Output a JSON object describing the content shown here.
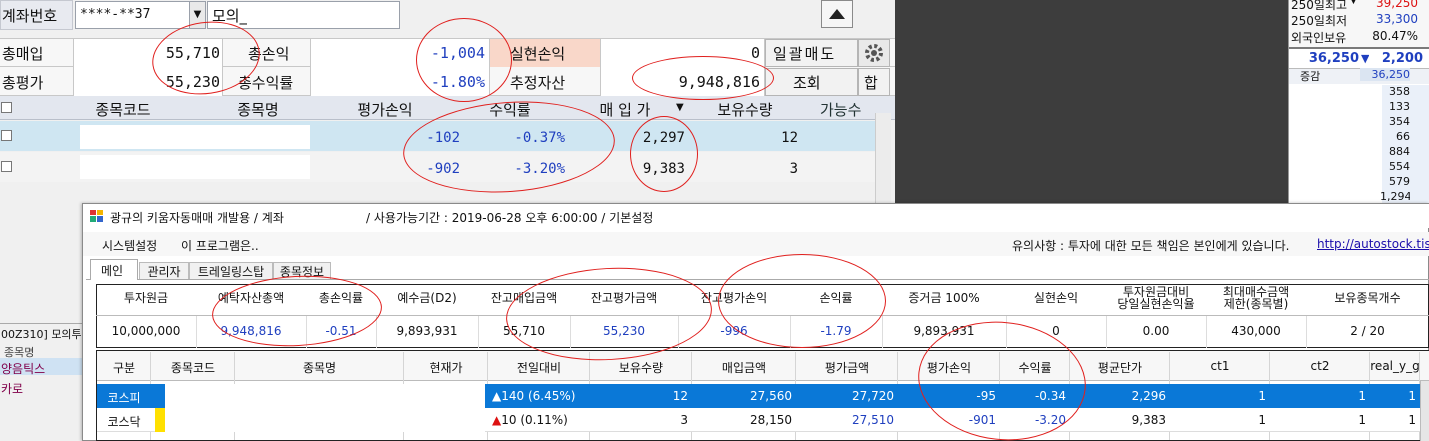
{
  "top": {
    "account_label": "계좌번호",
    "account_value": "****-**37",
    "mode_value": "모의_",
    "row1": {
      "l1": "총매입",
      "v1": "55,710",
      "l2": "총손익",
      "v2": "-1,004",
      "l3": "실현손익",
      "v3": "0",
      "btn": "일괄매도"
    },
    "row2": {
      "l1": "총평가",
      "v1": "55,230",
      "l2": "총수익률",
      "v2": "-1.80%",
      "l3": "추정자산",
      "v3": "9,948,816",
      "btn1": "조회",
      "btn2": "합"
    },
    "headers": [
      "종목코드",
      "종목명",
      "평가손익",
      "수익률",
      "매 입 가",
      "보유수량",
      "가능수"
    ],
    "rows": [
      {
        "pl": "-102",
        "rate": "-0.37%",
        "price": "2,297",
        "qty": "12"
      },
      {
        "pl": "-902",
        "rate": "-3.20%",
        "price": "9,383",
        "qty": "3"
      }
    ],
    "left_code": "00Z310] 모의투",
    "left_list": [
      "종목명",
      "양음틱스",
      "카로"
    ]
  },
  "right": {
    "rows": [
      {
        "label": "250일최고",
        "value": "39,250"
      },
      {
        "label": "250일최저",
        "value": "33,300"
      },
      {
        "label": "외국인보유",
        "value": "80.47%"
      }
    ],
    "price": "36,250",
    "change": "2,200",
    "tick_label": "증감",
    "tick_value": "36,250",
    "levels": [
      "358",
      "133",
      "354",
      "66",
      "884",
      "554",
      "579",
      "1,294"
    ]
  },
  "window": {
    "title": "광규의 키움자동매매 개발용 / 계좌",
    "title_info": "/ 사용가능기간 : 2019-06-28 오후 6:00:00 / 기본설정",
    "menu": [
      "시스템설정",
      "이 프로그램은.."
    ],
    "notice": "유의사항 : 투자에 대한 모든 책임은 본인에게 있습니다.",
    "link": "http://autostock.tisto",
    "tabs": [
      "메인",
      "관리자",
      "트레일링스탑",
      "종목정보"
    ],
    "summary_headers": [
      "투자원금",
      "예탁자산총액",
      "총손익률",
      "예수금(D2)",
      "잔고매입금액",
      "잔고평가금액",
      "잔고평가손익",
      "손익률",
      "증거금 100%",
      "실현손익",
      "투자원금대비\n당일실현손익율",
      "최대매수금액\n제한(종목별)",
      "보유종목개수"
    ],
    "summary_values": [
      "10,000,000",
      "9,948,816",
      "-0.51",
      "9,893,931",
      "55,710",
      "55,230",
      "-996",
      "-1.79",
      "9,893,931",
      "0",
      "0.00",
      "430,000",
      "2 / 20"
    ],
    "grid_headers": [
      "구분",
      "종목코드",
      "종목명",
      "현재가",
      "전일대비",
      "보유수량",
      "매입금액",
      "평가금액",
      "평가손익",
      "수익률",
      "평균단가",
      "ct1",
      "ct2",
      "real_y_g"
    ],
    "grid_rows": [
      {
        "market": "코스피",
        "change": "▲140 (6.45%)",
        "qty": "12",
        "buy": "27,560",
        "eval": "27,720",
        "pl": "-95",
        "rate": "-0.34",
        "avg": "2,296",
        "ct1": "1",
        "ct2": "1",
        "real": "1"
      },
      {
        "market": "코스닥",
        "change": "▲10 (0.11%)",
        "qty": "3",
        "buy": "28,150",
        "eval": "27,510",
        "pl": "-901",
        "rate": "-3.20",
        "avg": "9,383",
        "ct1": "1",
        "ct2": "1",
        "real": "1"
      }
    ]
  },
  "colors": {
    "accent": "#0a78d7",
    "blue": "#1f3fbf",
    "red": "#d11111",
    "annotation": "#e0201e"
  }
}
